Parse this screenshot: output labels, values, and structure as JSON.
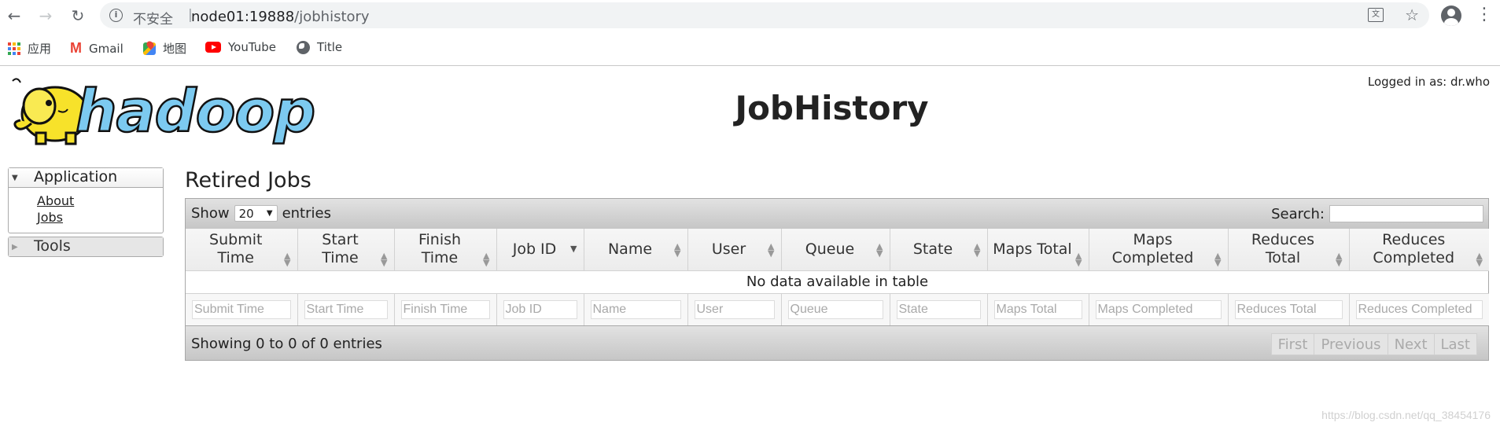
{
  "browser": {
    "security_label": "不安全",
    "url_host": "node01:19888",
    "url_path": "/jobhistory",
    "bookmarks": [
      {
        "label": "应用",
        "icon": "apps-icon"
      },
      {
        "label": "Gmail",
        "icon": "gmail-icon"
      },
      {
        "label": "地图",
        "icon": "maps-icon"
      },
      {
        "label": "YouTube",
        "icon": "youtube-icon"
      },
      {
        "label": "Title",
        "icon": "globe-icon"
      }
    ]
  },
  "header": {
    "logged_in": "Logged in as: dr.who",
    "logo_text": "hadoop",
    "title": "JobHistory"
  },
  "sidebar": {
    "application_label": "Application",
    "links": [
      "About",
      "Jobs"
    ],
    "tools_label": "Tools"
  },
  "main": {
    "section_title": "Retired Jobs",
    "show_label": "Show",
    "page_size": "20",
    "entries_label": "entries",
    "search_label": "Search:",
    "columns": [
      "Submit Time",
      "Start Time",
      "Finish Time",
      "Job ID",
      "Name",
      "User",
      "Queue",
      "State",
      "Maps Total",
      "Maps Completed",
      "Reduces Total",
      "Reduces Completed"
    ],
    "empty_message": "No data available in table",
    "filter_placeholders": [
      "Submit Time",
      "Start Time",
      "Finish Time",
      "Job ID",
      "Name",
      "User",
      "Queue",
      "State",
      "Maps Total",
      "Maps Completed",
      "Reduces Total",
      "Reduces Completed"
    ],
    "info_text": "Showing 0 to 0 of 0 entries",
    "pager": [
      "First",
      "Previous",
      "Next",
      "Last"
    ]
  },
  "watermark": "https://blog.csdn.net/qq_38454176",
  "colors": {
    "logo_blue": "#7ccaf0",
    "elephant_yellow": "#f7e22a"
  }
}
